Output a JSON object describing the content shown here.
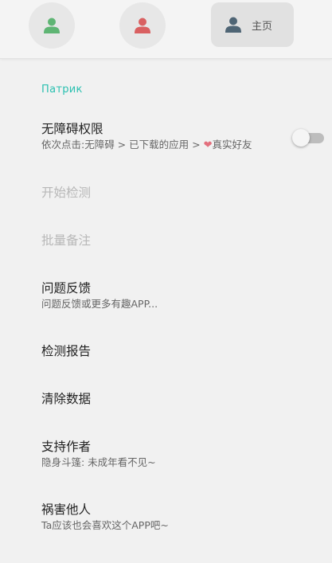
{
  "tabs": [
    {
      "icon": "person-icon",
      "color": "#5fb574",
      "label": ""
    },
    {
      "icon": "person-icon",
      "color": "#d96061",
      "label": ""
    },
    {
      "icon": "person-icon",
      "color": "#4f6575",
      "label": "主页",
      "selected": true
    }
  ],
  "section": {
    "header": "Патрик"
  },
  "items": {
    "accessibility": {
      "title": "无障碍权限",
      "subtitle_prefix": "依次点击:无障碍 > 已下载的应用 > ",
      "subtitle_suffix": "真实好友",
      "heart": "❤",
      "toggle_on": false
    },
    "start_detect": {
      "title": "开始检测",
      "disabled": true
    },
    "batch_note": {
      "title": "批量备注",
      "disabled": true
    },
    "feedback": {
      "title": "问题反馈",
      "subtitle": "问题反馈或更多有趣APP..."
    },
    "report": {
      "title": "检测报告"
    },
    "clear": {
      "title": "清除数据"
    },
    "support": {
      "title": "支持作者",
      "subtitle": "隐身斗篷: 未成年看不见~"
    },
    "share": {
      "title": "祸害他人",
      "subtitle": "Ta应该也会喜欢这个APP吧~"
    }
  },
  "colors": {
    "accent": "#2ac0b0",
    "background": "#f1f1f1",
    "disabled_text": "#b8b8b8"
  }
}
